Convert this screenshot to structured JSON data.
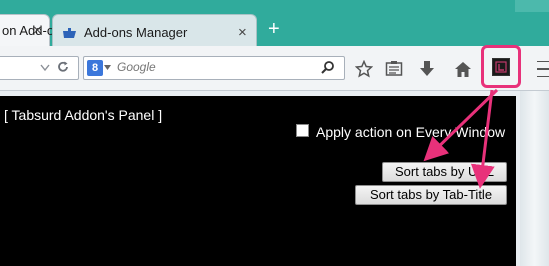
{
  "browser": {
    "tabs": [
      {
        "label": "on Add-ons Manager"
      },
      {
        "label": "Add-ons Manager"
      }
    ],
    "new_tab_symbol": "+",
    "close_symbol": "×",
    "search_placeholder": "Google",
    "search_engine_badge": "8"
  },
  "panel": {
    "title": "[ Tabsurd Addon's Panel ]",
    "apply_every_window_label": "Apply action on Every Window",
    "sort_by_url_label": "Sort tabs by URL",
    "sort_by_title_label": "Sort tabs by Tab-Title"
  },
  "colors": {
    "tabstrip": "#30ab9c",
    "highlight": "#e8317a",
    "panel_bg": "#000000"
  },
  "icons": [
    "puzzle-icon",
    "close-icon",
    "new-tab-icon",
    "search-icon",
    "reload-icon",
    "star-icon",
    "reading-list-icon",
    "download-icon",
    "home-icon",
    "tabsurd-addon-icon",
    "menu-icon"
  ]
}
